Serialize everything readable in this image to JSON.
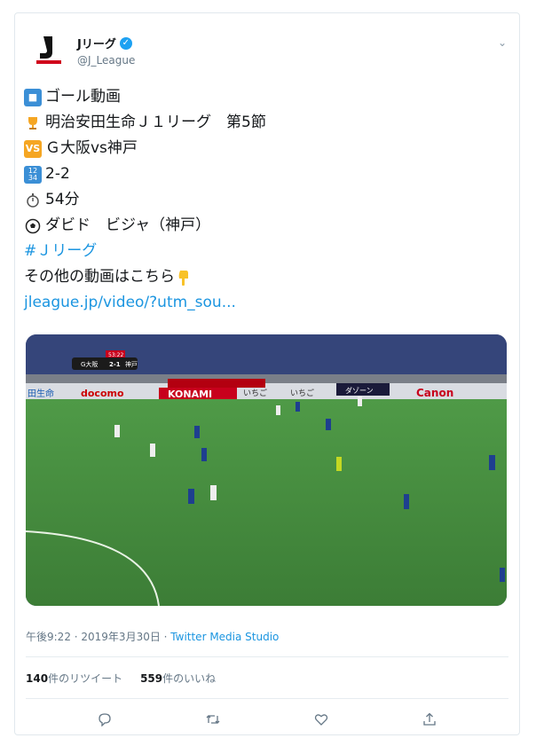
{
  "account": {
    "name": "Jリーグ",
    "handle": "@J_League"
  },
  "tweet": {
    "lines": {
      "l1": "ゴール動画",
      "l2": "明治安田生命Ｊ１リーグ　第5節",
      "l3": "Ｇ大阪vs神戸",
      "l4": "2-2",
      "l5": "54分",
      "l6": "ダビド　ビジャ（神戸）",
      "hashtag": "#Ｊリーグ",
      "l8": "その他の動画はこちら",
      "url": "jleague.jp/video/?utm_sou..."
    },
    "icons": {
      "vs_label": "VS"
    }
  },
  "media": {
    "scoreboard": {
      "time": "53:22",
      "home": "G大阪",
      "score": "2-1",
      "away": "神戸"
    },
    "ads": [
      "docomo",
      "KONAMI",
      "いちご",
      "いちご",
      "ダゾーン",
      "Canon",
      "田生命"
    ]
  },
  "meta": {
    "time": "午後9:22 · 2019年3月30日 · ",
    "source": "Twitter Media Studio"
  },
  "stats": {
    "retweets_count": "140",
    "retweets_label": "件のリツイート",
    "likes_count": "559",
    "likes_label": "件のいいね"
  },
  "colors": {
    "link": "#1b95e0",
    "pitch": "#3f8a3a",
    "verified": "#1da1f2"
  }
}
